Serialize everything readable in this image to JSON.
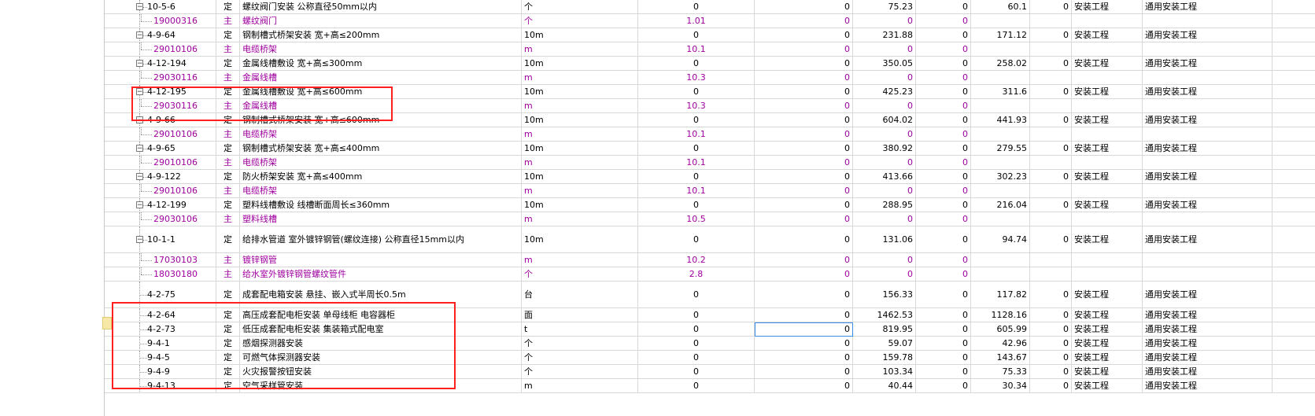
{
  "rows": [
    {
      "code": "10-5-6",
      "type": "定",
      "name": "螺纹阀门安装 公称直径50mm以内",
      "unit": "个",
      "qty": "0",
      "v1": "0",
      "v2": "75.23",
      "v3": "0",
      "v4": "60.1",
      "v5": "0",
      "cat": "安装工程",
      "cat2": "通用安装工程",
      "kind": "parent"
    },
    {
      "code": "19000316",
      "type": "主",
      "name": "螺纹阀门",
      "unit": "个",
      "qty": "1.01",
      "v1": "0",
      "v2": "0",
      "v3": "0",
      "v4": "",
      "v5": "",
      "cat": "",
      "cat2": "",
      "kind": "child"
    },
    {
      "code": "4-9-64",
      "type": "定",
      "name": "钢制槽式桥架安装 宽+高≤200mm",
      "unit": "10m",
      "qty": "0",
      "v1": "0",
      "v2": "231.88",
      "v3": "0",
      "v4": "171.12",
      "v5": "0",
      "cat": "安装工程",
      "cat2": "通用安装工程",
      "kind": "parent"
    },
    {
      "code": "29010106",
      "type": "主",
      "name": "电缆桥架",
      "unit": "m",
      "qty": "10.1",
      "v1": "0",
      "v2": "0",
      "v3": "0",
      "v4": "",
      "v5": "",
      "cat": "",
      "cat2": "",
      "kind": "child"
    },
    {
      "code": "4-12-194",
      "type": "定",
      "name": "金属线槽敷设 宽+高≤300mm",
      "unit": "10m",
      "qty": "0",
      "v1": "0",
      "v2": "350.05",
      "v3": "0",
      "v4": "258.02",
      "v5": "0",
      "cat": "安装工程",
      "cat2": "通用安装工程",
      "kind": "parent"
    },
    {
      "code": "29030116",
      "type": "主",
      "name": "金属线槽",
      "unit": "m",
      "qty": "10.3",
      "v1": "0",
      "v2": "0",
      "v3": "0",
      "v4": "",
      "v5": "",
      "cat": "",
      "cat2": "",
      "kind": "child"
    },
    {
      "code": "4-12-195",
      "type": "定",
      "name": "金属线槽敷设 宽+高≤600mm",
      "unit": "10m",
      "qty": "0",
      "v1": "0",
      "v2": "425.23",
      "v3": "0",
      "v4": "311.6",
      "v5": "0",
      "cat": "安装工程",
      "cat2": "通用安装工程",
      "kind": "parent"
    },
    {
      "code": "29030116",
      "type": "主",
      "name": "金属线槽",
      "unit": "m",
      "qty": "10.3",
      "v1": "0",
      "v2": "0",
      "v3": "0",
      "v4": "",
      "v5": "",
      "cat": "",
      "cat2": "",
      "kind": "child"
    },
    {
      "code": "4-9-66",
      "type": "定",
      "name": "钢制槽式桥架安装 宽+高≤600mm",
      "unit": "10m",
      "qty": "0",
      "v1": "0",
      "v2": "604.02",
      "v3": "0",
      "v4": "441.93",
      "v5": "0",
      "cat": "安装工程",
      "cat2": "通用安装工程",
      "kind": "parent"
    },
    {
      "code": "29010106",
      "type": "主",
      "name": "电缆桥架",
      "unit": "m",
      "qty": "10.1",
      "v1": "0",
      "v2": "0",
      "v3": "0",
      "v4": "",
      "v5": "",
      "cat": "",
      "cat2": "",
      "kind": "child"
    },
    {
      "code": "4-9-65",
      "type": "定",
      "name": "钢制槽式桥架安装 宽+高≤400mm",
      "unit": "10m",
      "qty": "0",
      "v1": "0",
      "v2": "380.92",
      "v3": "0",
      "v4": "279.55",
      "v5": "0",
      "cat": "安装工程",
      "cat2": "通用安装工程",
      "kind": "parent"
    },
    {
      "code": "29010106",
      "type": "主",
      "name": "电缆桥架",
      "unit": "m",
      "qty": "10.1",
      "v1": "0",
      "v2": "0",
      "v3": "0",
      "v4": "",
      "v5": "",
      "cat": "",
      "cat2": "",
      "kind": "child"
    },
    {
      "code": "4-9-122",
      "type": "定",
      "name": "防火桥架安装 宽+高≤400mm",
      "unit": "10m",
      "qty": "0",
      "v1": "0",
      "v2": "413.66",
      "v3": "0",
      "v4": "302.23",
      "v5": "0",
      "cat": "安装工程",
      "cat2": "通用安装工程",
      "kind": "parent"
    },
    {
      "code": "29010106",
      "type": "主",
      "name": "电缆桥架",
      "unit": "m",
      "qty": "10.1",
      "v1": "0",
      "v2": "0",
      "v3": "0",
      "v4": "",
      "v5": "",
      "cat": "",
      "cat2": "",
      "kind": "child"
    },
    {
      "code": "4-12-199",
      "type": "定",
      "name": "塑料线槽敷设 线槽断面周长≤360mm",
      "unit": "10m",
      "qty": "0",
      "v1": "0",
      "v2": "288.95",
      "v3": "0",
      "v4": "216.04",
      "v5": "0",
      "cat": "安装工程",
      "cat2": "通用安装工程",
      "kind": "parent"
    },
    {
      "code": "29030106",
      "type": "主",
      "name": "塑料线槽",
      "unit": "m",
      "qty": "10.5",
      "v1": "0",
      "v2": "0",
      "v3": "0",
      "v4": "",
      "v5": "",
      "cat": "",
      "cat2": "",
      "kind": "child"
    },
    {
      "code": "10-1-1",
      "type": "定",
      "name": "给排水管道 室外镀锌钢管(螺纹连接) 公称直径15mm以内",
      "unit": "10m",
      "qty": "0",
      "v1": "0",
      "v2": "131.06",
      "v3": "0",
      "v4": "94.74",
      "v5": "0",
      "cat": "安装工程",
      "cat2": "通用安装工程",
      "kind": "parent",
      "tall": true
    },
    {
      "code": "17030103",
      "type": "主",
      "name": "镀锌钢管",
      "unit": "m",
      "qty": "10.2",
      "v1": "0",
      "v2": "0",
      "v3": "0",
      "v4": "",
      "v5": "",
      "cat": "",
      "cat2": "",
      "kind": "child"
    },
    {
      "code": "18030180",
      "type": "主",
      "name": "给水室外镀锌钢管螺纹管件",
      "unit": "个",
      "qty": "2.8",
      "v1": "0",
      "v2": "0",
      "v3": "0",
      "v4": "",
      "v5": "",
      "cat": "",
      "cat2": "",
      "kind": "child"
    },
    {
      "code": "4-2-75",
      "type": "定",
      "name": "成套配电箱安装 悬挂、嵌入式半周长0.5m",
      "unit": "台",
      "qty": "0",
      "v1": "0",
      "v2": "156.33",
      "v3": "0",
      "v4": "117.82",
      "v5": "0",
      "cat": "安装工程",
      "cat2": "通用安装工程",
      "kind": "leaf",
      "tall": true
    },
    {
      "code": "4-2-64",
      "type": "定",
      "name": "高压成套配电柜安装 单母线柜 电容器柜",
      "unit": "面",
      "qty": "0",
      "v1": "0",
      "v2": "1462.53",
      "v3": "0",
      "v4": "1128.16",
      "v5": "0",
      "cat": "安装工程",
      "cat2": "通用安装工程",
      "kind": "leaf"
    },
    {
      "code": "4-2-73",
      "type": "定",
      "name": "低压成套配电柜安装 集装箱式配电室",
      "unit": "t",
      "qty": "0",
      "v1": "0",
      "v2": "819.95",
      "v3": "0",
      "v4": "605.99",
      "v5": "0",
      "cat": "安装工程",
      "cat2": "通用安装工程",
      "kind": "leaf",
      "selected": true
    },
    {
      "code": "9-4-1",
      "type": "定",
      "name": "感烟探测器安装",
      "unit": "个",
      "qty": "0",
      "v1": "0",
      "v2": "59.07",
      "v3": "0",
      "v4": "42.96",
      "v5": "0",
      "cat": "安装工程",
      "cat2": "通用安装工程",
      "kind": "leaf"
    },
    {
      "code": "9-4-5",
      "type": "定",
      "name": "可燃气体探测器安装",
      "unit": "个",
      "qty": "0",
      "v1": "0",
      "v2": "159.78",
      "v3": "0",
      "v4": "143.67",
      "v5": "0",
      "cat": "安装工程",
      "cat2": "通用安装工程",
      "kind": "leaf"
    },
    {
      "code": "9-4-9",
      "type": "定",
      "name": "火灾报警按钮安装",
      "unit": "个",
      "qty": "0",
      "v1": "0",
      "v2": "103.34",
      "v3": "0",
      "v4": "75.33",
      "v5": "0",
      "cat": "安装工程",
      "cat2": "通用安装工程",
      "kind": "leaf"
    },
    {
      "code": "9-4-13",
      "type": "定",
      "name": "空气采样管安装",
      "unit": "m",
      "qty": "0",
      "v1": "0",
      "v2": "40.44",
      "v3": "0",
      "v4": "30.34",
      "v5": "0",
      "cat": "安装工程",
      "cat2": "通用安装工程",
      "kind": "leaf"
    }
  ],
  "colors": {
    "child_text": "#a000a0",
    "highlight": "#ff2020",
    "marker": "#f7e8a8"
  }
}
